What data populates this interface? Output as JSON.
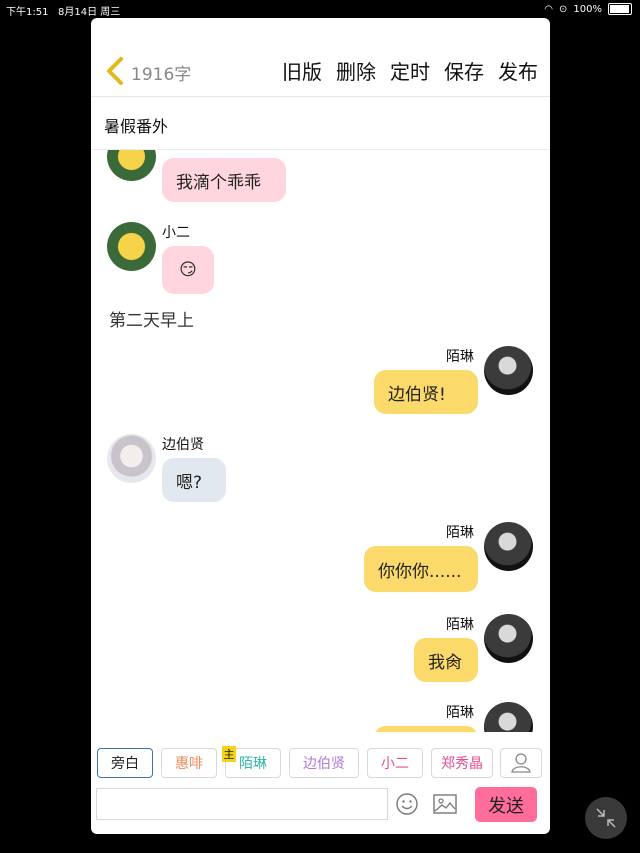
{
  "status_bar": {
    "time": "下午1:51",
    "date": "8月14日 周三",
    "battery": "100%"
  },
  "header": {
    "word_count": "1916字",
    "actions": [
      "旧版",
      "删除",
      "定时",
      "保存",
      "发布"
    ],
    "chapter_title": "暑假番外"
  },
  "chat": {
    "narration": "第二天早上",
    "messages": [
      {
        "speaker": "",
        "text": "我滴个乖乖"
      },
      {
        "speaker": "小二",
        "text": "😏"
      },
      {
        "speaker": "陌琳",
        "text": "边伯贤!"
      },
      {
        "speaker": "边伯贤",
        "text": "嗯?"
      },
      {
        "speaker": "陌琳",
        "text": "你你你......"
      },
      {
        "speaker": "陌琳",
        "text": "我肏"
      },
      {
        "speaker": "陌琳",
        "text": ""
      }
    ]
  },
  "roles": [
    {
      "label": "旁白",
      "color": "#222222"
    },
    {
      "label": "惠啡",
      "color": "#f08a5a"
    },
    {
      "label": "陌琳",
      "color": "#2fb8a8"
    },
    {
      "label": "边伯贤",
      "color": "#b07ad8"
    },
    {
      "label": "小二",
      "color": "#e8507a"
    },
    {
      "label": "郑秀晶",
      "color": "#e05090"
    }
  ],
  "host_badge": "主",
  "composer": {
    "placeholder": "",
    "send_label": "发送"
  },
  "colors": {
    "send": "#ff6d9b",
    "bubble_pink": "#ffd5de",
    "bubble_yellow": "#fbd96a",
    "bubble_gray": "#e2e8f0"
  }
}
